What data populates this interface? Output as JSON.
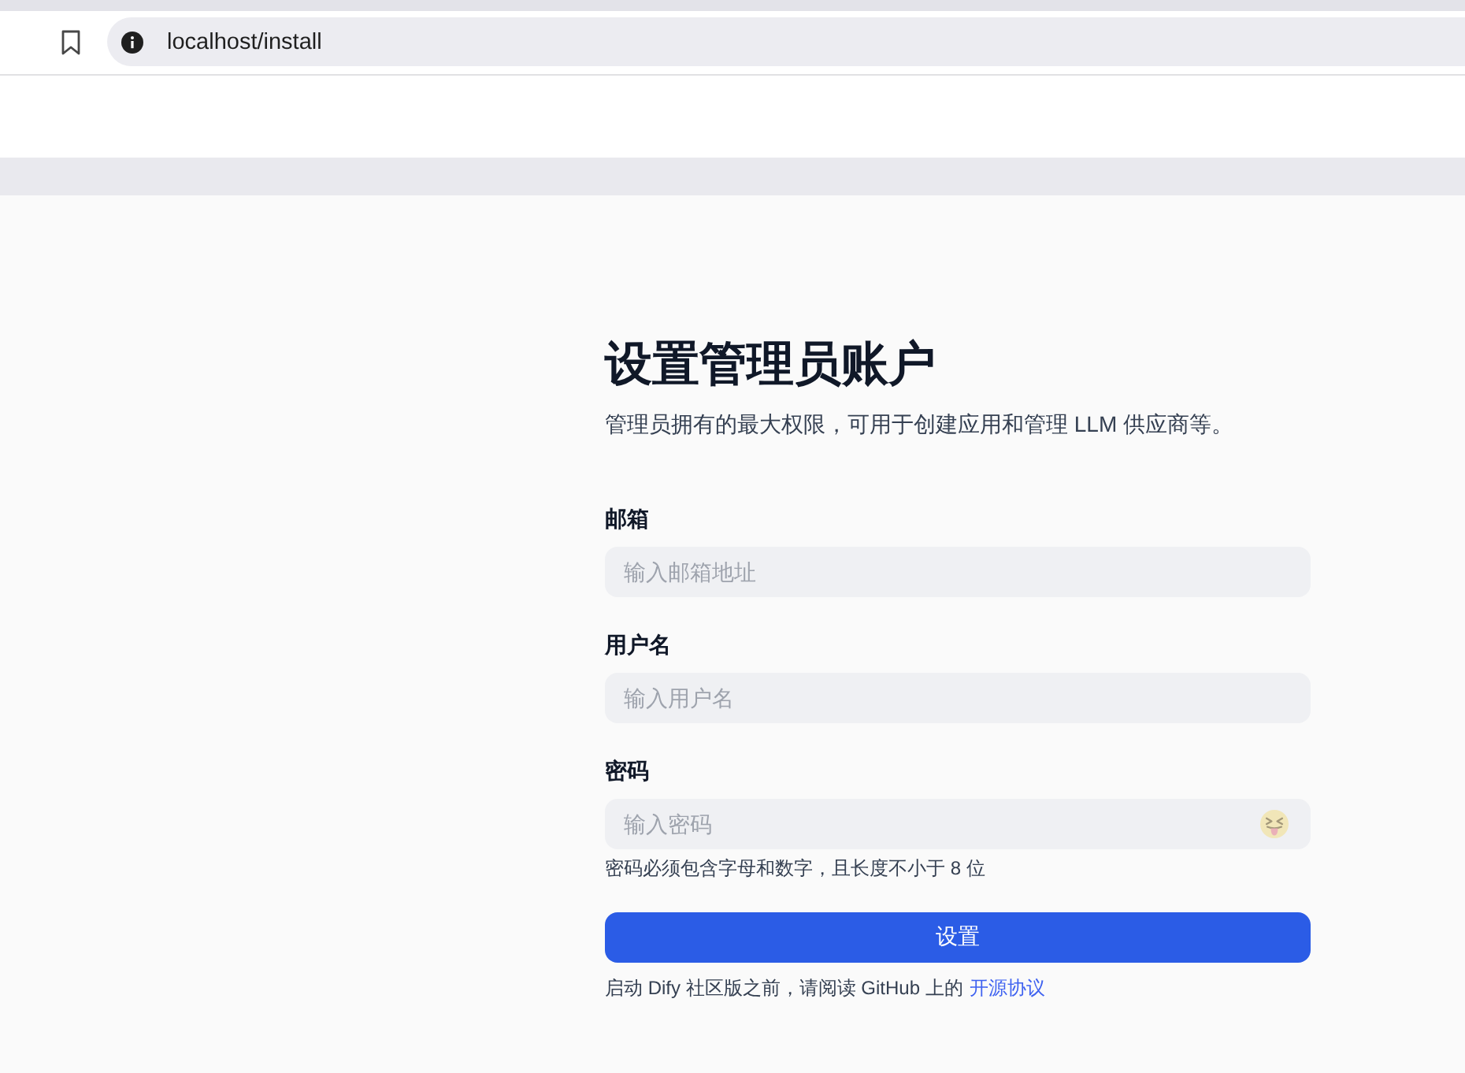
{
  "browser": {
    "url": "localhost/install"
  },
  "form": {
    "title": "设置管理员账户",
    "subtitle": "管理员拥有的最大权限，可用于创建应用和管理 LLM 供应商等。",
    "fields": [
      {
        "kind": "plain",
        "label": "邮箱",
        "placeholder": "输入邮箱地址"
      },
      {
        "kind": "plain",
        "label": "用户名",
        "placeholder": "输入用户名"
      },
      {
        "kind": "password",
        "label": "密码",
        "placeholder": "输入密码",
        "hint": "密码必须包含字母和数字，且长度不小于 8 位"
      }
    ],
    "submit_button": "设置",
    "footer": {
      "text": "启动 Dify 社区版之前，请阅读 GitHub 上的",
      "link": "开源协议"
    }
  }
}
